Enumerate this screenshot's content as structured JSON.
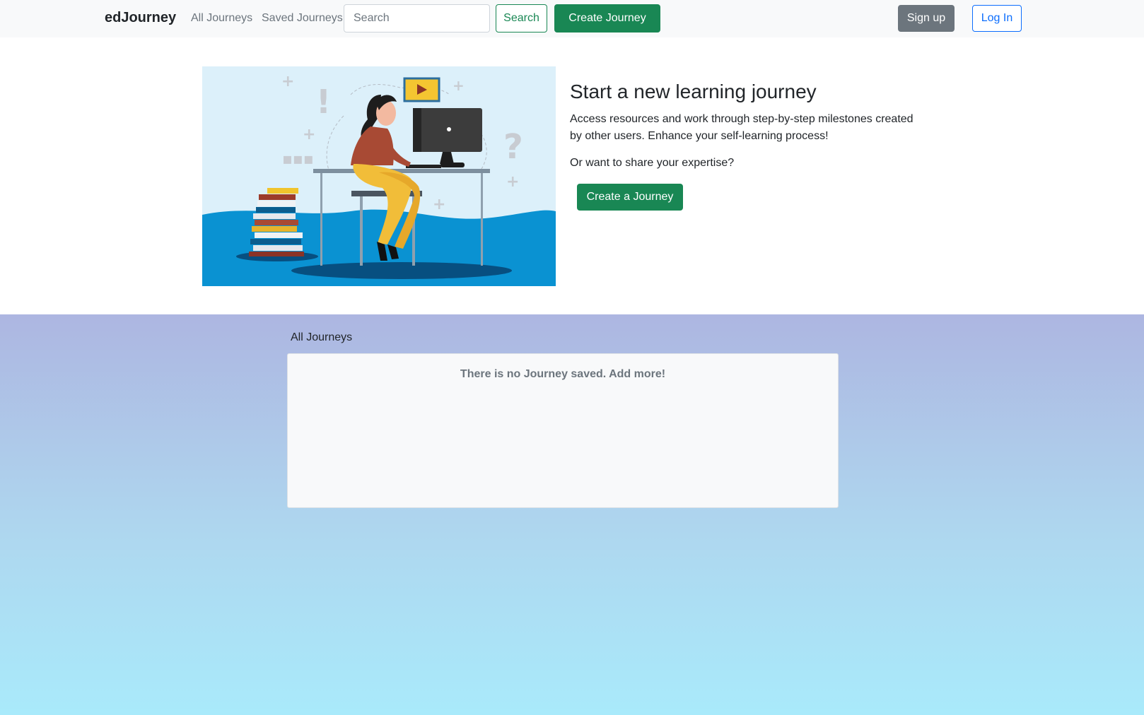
{
  "navbar": {
    "brand": "edJourney",
    "links": [
      "All Journeys",
      "Saved Journeys"
    ],
    "search_placeholder": "Search",
    "search_button": "Search",
    "create_button": "Create Journey",
    "signup_button": "Sign up",
    "login_button": "Log In"
  },
  "hero": {
    "title": "Start a new learning journey",
    "description": "Access resources and work through step-by-step milestones created by other users. Enhance your self-learning process!",
    "question": "Or want to share your expertise?",
    "cta": "Create a Journey"
  },
  "journeys": {
    "section_label": "All Journeys",
    "empty_message": "There is no Journey saved. Add more!"
  },
  "colors": {
    "primary_green": "#198754",
    "secondary_gray": "#6c757d",
    "link_blue": "#0d6efd"
  }
}
